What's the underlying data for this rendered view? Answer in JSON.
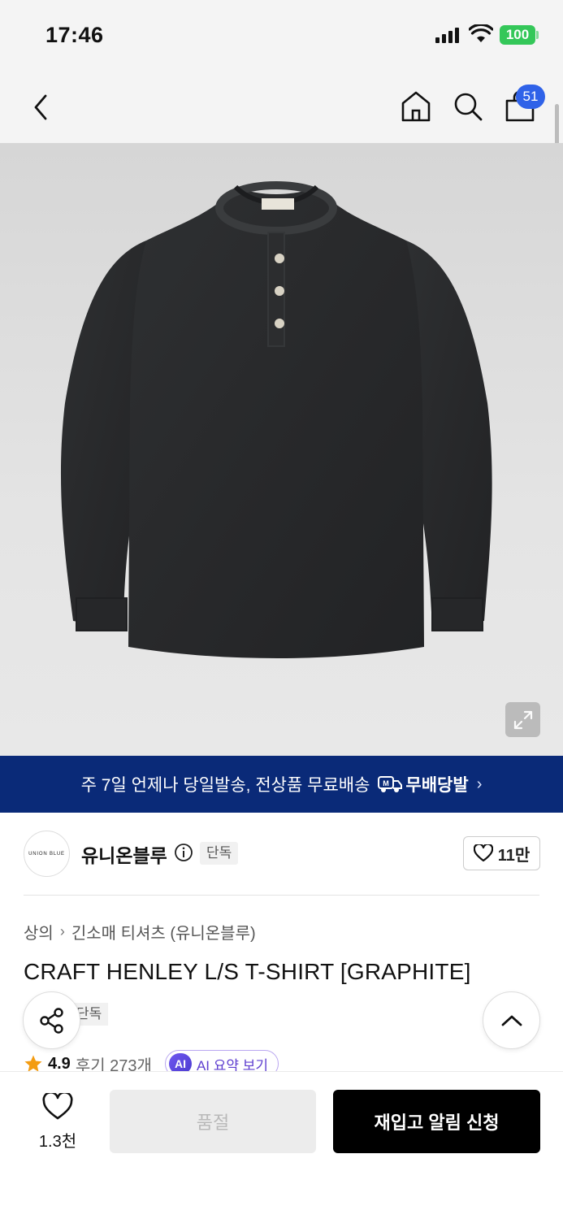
{
  "status_bar": {
    "time": "17:46",
    "battery": "100"
  },
  "nav": {
    "cart_count": "51",
    "icons": [
      "back-icon",
      "home-icon",
      "search-icon",
      "shopping-bag-icon"
    ]
  },
  "banner": {
    "text": "주 7일 언제나 당일발송, 전상품 무료배송",
    "brand": "무배당발",
    "chevron": "›"
  },
  "brand": {
    "logo_text": "UNION BLUE",
    "name": "유니온블루",
    "tag": "단독",
    "likes": "11만"
  },
  "breadcrumb": {
    "level1": "상의",
    "separator": "›",
    "level2": "긴소매 티셔츠 (유니온블루)"
  },
  "product": {
    "title": "CRAFT HENLEY L/S T-SHIRT [GRAPHITE]",
    "tag": "단독",
    "rating": "4.9",
    "reviews": "후기 273개",
    "ai_badge": "AI",
    "ai_label": "AI 요약 보기"
  },
  "bottom_bar": {
    "wish_count": "1.3천",
    "soldout_label": "품절",
    "restock_label": "재입고 알림 신청"
  },
  "colors": {
    "banner_bg": "#0a2a78",
    "badge": "#2f62e8",
    "battery": "#34c759",
    "ai_purple": "#5e3fd0",
    "star": "#f39c12"
  }
}
